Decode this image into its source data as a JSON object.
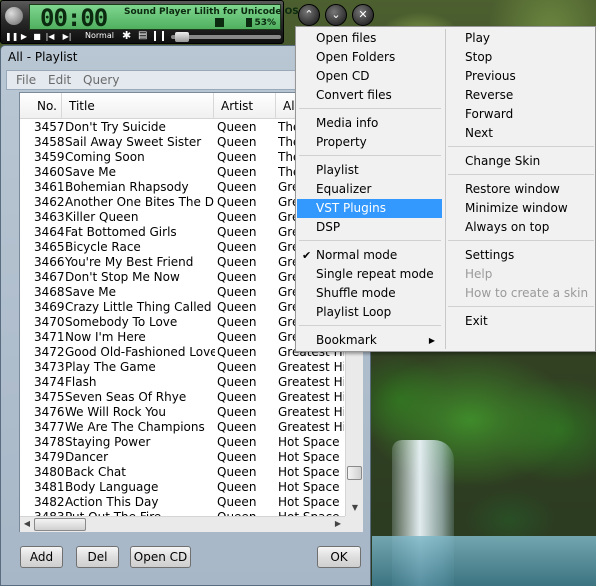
{
  "player": {
    "time": "00:00",
    "track_title": "Sound Player Lilith for Unicode OSs",
    "volume_percent": "53%",
    "mode_label": "Normal",
    "controls": [
      "pause-icon",
      "play-icon",
      "stop-icon",
      "previous-icon",
      "next-icon"
    ],
    "window_buttons": [
      "collapse-up-icon",
      "expand-down-icon",
      "close-icon"
    ]
  },
  "playlist_window": {
    "title": "All - Playlist",
    "menu": [
      "File",
      "Edit",
      "Query"
    ],
    "columns": [
      "No.",
      "Title",
      "Artist",
      "Al"
    ],
    "rows": [
      {
        "no": "3457",
        "title": "Don't Try Suicide",
        "artist": "Queen",
        "album": "The"
      },
      {
        "no": "3458",
        "title": "Sail Away Sweet Sister",
        "artist": "Queen",
        "album": "The"
      },
      {
        "no": "3459",
        "title": "Coming Soon",
        "artist": "Queen",
        "album": "The"
      },
      {
        "no": "3460",
        "title": "Save Me",
        "artist": "Queen",
        "album": "The"
      },
      {
        "no": "3461",
        "title": "Bohemian Rhapsody",
        "artist": "Queen",
        "album": "Gre"
      },
      {
        "no": "3462",
        "title": "Another One Bites The Dust",
        "artist": "Queen",
        "album": "Gre"
      },
      {
        "no": "3463",
        "title": "Killer Queen",
        "artist": "Queen",
        "album": "Gre"
      },
      {
        "no": "3464",
        "title": "Fat Bottomed Girls",
        "artist": "Queen",
        "album": "Gre"
      },
      {
        "no": "3465",
        "title": "Bicycle Race",
        "artist": "Queen",
        "album": "Gre"
      },
      {
        "no": "3466",
        "title": "You're My Best Friend",
        "artist": "Queen",
        "album": "Gre"
      },
      {
        "no": "3467",
        "title": "Don't Stop Me Now",
        "artist": "Queen",
        "album": "Gre"
      },
      {
        "no": "3468",
        "title": "Save Me",
        "artist": "Queen",
        "album": "Gre"
      },
      {
        "no": "3469",
        "title": "Crazy Little Thing Called L...",
        "artist": "Queen",
        "album": "Gre"
      },
      {
        "no": "3470",
        "title": "Somebody To Love",
        "artist": "Queen",
        "album": "Gre"
      },
      {
        "no": "3471",
        "title": "Now I'm Here",
        "artist": "Queen",
        "album": "Gre"
      },
      {
        "no": "3472",
        "title": "Good Old-Fashioned Love...",
        "artist": "Queen",
        "album": "Greatest Hits"
      },
      {
        "no": "3473",
        "title": "Play The Game",
        "artist": "Queen",
        "album": "Greatest Hits"
      },
      {
        "no": "3474",
        "title": "Flash",
        "artist": "Queen",
        "album": "Greatest Hits"
      },
      {
        "no": "3475",
        "title": "Seven Seas Of Rhye",
        "artist": "Queen",
        "album": "Greatest Hits"
      },
      {
        "no": "3476",
        "title": "We Will Rock You",
        "artist": "Queen",
        "album": "Greatest Hits"
      },
      {
        "no": "3477",
        "title": "We Are The Champions",
        "artist": "Queen",
        "album": "Greatest Hits"
      },
      {
        "no": "3478",
        "title": "Staying Power",
        "artist": "Queen",
        "album": "Hot Space"
      },
      {
        "no": "3479",
        "title": "Dancer",
        "artist": "Queen",
        "album": "Hot Space"
      },
      {
        "no": "3480",
        "title": "Back Chat",
        "artist": "Queen",
        "album": "Hot Space"
      },
      {
        "no": "3481",
        "title": "Body Language",
        "artist": "Queen",
        "album": "Hot Space"
      },
      {
        "no": "3482",
        "title": "Action This Day",
        "artist": "Queen",
        "album": "Hot Space"
      },
      {
        "no": "3483",
        "title": "Put Out The Fire",
        "artist": "Queen",
        "album": "Hot Space"
      }
    ],
    "buttons": {
      "add": "Add",
      "del": "Del",
      "open_cd": "Open CD",
      "ok": "OK"
    }
  },
  "context_menu": {
    "left": {
      "open_files": "Open files",
      "open_folders": "Open Folders",
      "open_cd": "Open CD",
      "convert_files": "Convert files",
      "media_info": "Media info",
      "property": "Property",
      "playlist": "Playlist",
      "equalizer": "Equalizer",
      "vst_plugins": "VST Plugins",
      "dsp": "DSP",
      "normal_mode": "Normal mode",
      "single_repeat_mode": "Single repeat mode",
      "shuffle_mode": "Shuffle mode",
      "playlist_loop": "Playlist Loop",
      "bookmark": "Bookmark"
    },
    "right": {
      "play": "Play",
      "stop": "Stop",
      "previous": "Previous",
      "reverse": "Reverse",
      "forward": "Forward",
      "next": "Next",
      "change_skin": "Change Skin",
      "restore_window": "Restore window",
      "minimize_window": "Minimize window",
      "always_on_top": "Always on top",
      "settings": "Settings",
      "help": "Help",
      "how_to_create_skin": "How to create a skin",
      "exit": "Exit"
    },
    "highlighted": "VST Plugins",
    "checked": "Normal mode",
    "highlight_color": "#3399ff"
  }
}
